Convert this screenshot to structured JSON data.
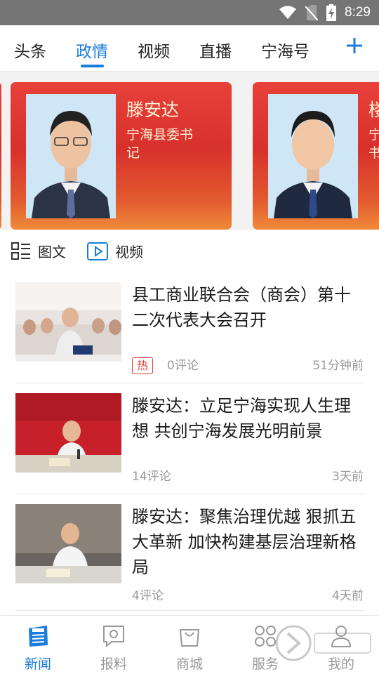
{
  "status_bar": {
    "time": "8:29"
  },
  "tabs": [
    {
      "label": "头条"
    },
    {
      "label": "政情"
    },
    {
      "label": "视频"
    },
    {
      "label": "直播"
    },
    {
      "label": "宁海号"
    }
  ],
  "carousel": [
    {
      "name": "滕安达",
      "title": "宁海县委书\n记"
    },
    {
      "name": "楼",
      "title": "宁\n书"
    }
  ],
  "filters": [
    {
      "label": "图文"
    },
    {
      "label": "视频"
    }
  ],
  "news": [
    {
      "headline": "县工商业联合会（商会）第十二次代表大会召开",
      "hot": "热",
      "comments": "0评论",
      "time": "51分钟前"
    },
    {
      "headline": "滕安达：立足宁海实现人生理想 共创宁海发展光明前景",
      "hot": "",
      "comments": "14评论",
      "time": "3天前"
    },
    {
      "headline": "滕安达：聚焦治理优越 狠抓五大革新 加快构建基层治理新格局",
      "hot": "",
      "comments": "4评论",
      "time": "4天前"
    }
  ],
  "bottom_nav": [
    {
      "label": "新闻"
    },
    {
      "label": "报料"
    },
    {
      "label": "商城"
    },
    {
      "label": "服务"
    },
    {
      "label": "我的"
    }
  ],
  "colors": {
    "accent": "#1a7cdb",
    "hot": "#e03d32",
    "card_red": "#d8302c"
  }
}
